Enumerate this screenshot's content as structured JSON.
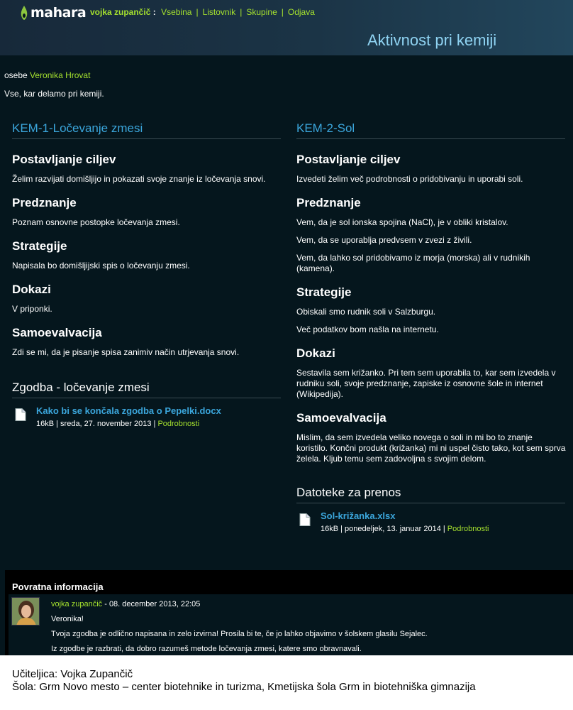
{
  "header": {
    "logo_text": "mahara",
    "user": "vojka zupančič",
    "colon": ":",
    "nav": [
      "Vsebina",
      "Listovnik",
      "Skupine",
      "Odjava"
    ],
    "page_title": "Aktivnost pri kemiji"
  },
  "owner": {
    "prefix": "osebe",
    "name": "Veronika Hrovat"
  },
  "description": "Vse, kar delamo pri kemiji.",
  "left": {
    "title": "KEM-1-Ločevanje zmesi",
    "sections": [
      {
        "heading": "Postavljanje ciljev",
        "text": "Želim razvijati domišljijo in pokazati svoje znanje iz ločevanja snovi."
      },
      {
        "heading": "Predznanje",
        "text": "Poznam osnovne postopke ločevanja zmesi."
      },
      {
        "heading": "Strategije",
        "text": "Napisala bo domišljijski spis o ločevanju zmesi."
      },
      {
        "heading": "Dokazi",
        "text": "V priponki."
      },
      {
        "heading": "Samoevalvacija",
        "text": "Zdi se mi, da je pisanje spisa zanimiv način utrjevanja snovi."
      }
    ],
    "files_block": {
      "title": "Zgodba - ločevanje zmesi",
      "file_name": "Kako bi se končala zgodba o Pepelki.docx",
      "file_meta": "16kB | sreda, 27. november 2013 |",
      "details": "Podrobnosti"
    }
  },
  "right": {
    "title": "KEM-2-Sol",
    "goal_heading": "Postavljanje ciljev",
    "goal_text": "Izvedeti želim več podrobnosti o pridobivanju in uporabi soli.",
    "prior_heading": "Predznanje",
    "prior_1": "Vem, da je sol ionska spojina (NaCl), je v obliki kristalov.",
    "prior_2": "Vem, da se uporablja predvsem v zvezi z živili.",
    "prior_3": "Vem, da lahko sol pridobivamo iz morja (morska) ali v rudnikih (kamena).",
    "strat_heading": "Strategije",
    "strat_1": "Obiskali smo rudnik soli v Salzburgu.",
    "strat_2": "Več podatkov bom našla na internetu.",
    "evid_heading": "Dokazi",
    "evid_text": "Sestavila sem križanko. Pri tem sem uporabila to, kar sem izvedela v rudniku soli, svoje predznanje, zapiske iz osnovne šole in internet (Wikipedija).",
    "self_heading": "Samoevalvacija",
    "self_text": "Mislim, da sem izvedela veliko novega o soli in mi bo to znanje koristilo. Končni produkt (križanka) mi ni uspel čisto tako, kot sem sprva želela. Kljub temu sem zadovoljna s svojim delom.",
    "files_block": {
      "title": "Datoteke za prenos",
      "file_name": "Sol-križanka.xlsx",
      "file_meta": "16kB | ponedeljek, 13. januar 2014 |",
      "details": "Podrobnosti"
    }
  },
  "feedback": {
    "title": "Povratna informacija",
    "author": "vojka zupančič",
    "date": "- 08. december 2013, 22:05",
    "line1": "Veronika!",
    "line2": "Tvoja zgodba je odlično napisana in zelo izvirna! Prosila bi te, če jo lahko objavimo v šolskem glasilu Sejalec.",
    "line3": "Iz zgodbe je razbrati, da dobro razumeš metode ločevanja zmesi, katere smo obravnavali."
  },
  "footer": {
    "teacher": "Učiteljica: Vojka Zupančič",
    "school": "Šola: Grm Novo mesto – center biotehnike in turizma,  Kmetijska šola Grm in biotehniška gimnazija"
  },
  "colors": {
    "accent_green": "#a6e22e",
    "link_blue": "#3ba6dc",
    "bg_dark": "#05161d"
  }
}
